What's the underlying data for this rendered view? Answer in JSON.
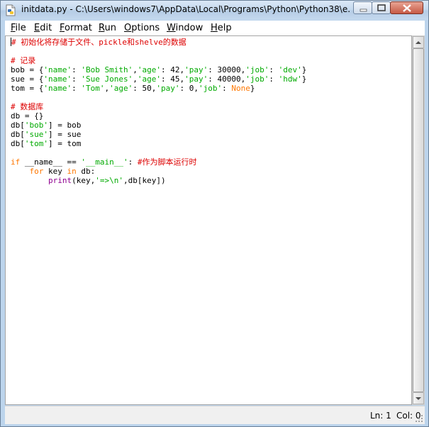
{
  "window": {
    "title": "initdata.py - C:\\Users\\windows7\\AppData\\Local\\Programs\\Python\\Python38\\e...",
    "app_icon": "python-file-icon"
  },
  "menu": [
    {
      "first": "F",
      "rest": "ile"
    },
    {
      "first": "E",
      "rest": "dit"
    },
    {
      "first": "F",
      "rest": "ormat"
    },
    {
      "first": "R",
      "rest": "un"
    },
    {
      "first": "O",
      "rest": "ptions"
    },
    {
      "first": "W",
      "rest": "indow"
    },
    {
      "first": "H",
      "rest": "elp"
    }
  ],
  "code_lines": [
    [
      {
        "t": "# 初始化将存储于文件、pickle和shelve的数据",
        "c": "cm"
      }
    ],
    [],
    [
      {
        "t": "# 记录",
        "c": "cm"
      }
    ],
    [
      {
        "t": "bob = {"
      },
      {
        "t": "'name'",
        "c": "str"
      },
      {
        "t": ": "
      },
      {
        "t": "'Bob Smith'",
        "c": "str"
      },
      {
        "t": ","
      },
      {
        "t": "'age'",
        "c": "str"
      },
      {
        "t": ": 42,"
      },
      {
        "t": "'pay'",
        "c": "str"
      },
      {
        "t": ": 30000,"
      },
      {
        "t": "'job'",
        "c": "str"
      },
      {
        "t": ": "
      },
      {
        "t": "'dev'",
        "c": "str"
      },
      {
        "t": "}"
      }
    ],
    [
      {
        "t": "sue = {"
      },
      {
        "t": "'name'",
        "c": "str"
      },
      {
        "t": ": "
      },
      {
        "t": "'Sue Jones'",
        "c": "str"
      },
      {
        "t": ","
      },
      {
        "t": "'age'",
        "c": "str"
      },
      {
        "t": ": 45,"
      },
      {
        "t": "'pay'",
        "c": "str"
      },
      {
        "t": ": 40000,"
      },
      {
        "t": "'job'",
        "c": "str"
      },
      {
        "t": ": "
      },
      {
        "t": "'hdw'",
        "c": "str"
      },
      {
        "t": "}"
      }
    ],
    [
      {
        "t": "tom = {"
      },
      {
        "t": "'name'",
        "c": "str"
      },
      {
        "t": ": "
      },
      {
        "t": "'Tom'",
        "c": "str"
      },
      {
        "t": ","
      },
      {
        "t": "'age'",
        "c": "str"
      },
      {
        "t": ": 50,"
      },
      {
        "t": "'pay'",
        "c": "str"
      },
      {
        "t": ": 0,"
      },
      {
        "t": "'job'",
        "c": "str"
      },
      {
        "t": ": "
      },
      {
        "t": "None",
        "c": "kw"
      },
      {
        "t": "}"
      }
    ],
    [],
    [
      {
        "t": "# 数据库",
        "c": "cm"
      }
    ],
    [
      {
        "t": "db = {}"
      }
    ],
    [
      {
        "t": "db["
      },
      {
        "t": "'bob'",
        "c": "str"
      },
      {
        "t": "] = bob"
      }
    ],
    [
      {
        "t": "db["
      },
      {
        "t": "'sue'",
        "c": "str"
      },
      {
        "t": "] = sue"
      }
    ],
    [
      {
        "t": "db["
      },
      {
        "t": "'tom'",
        "c": "str"
      },
      {
        "t": "] = tom"
      }
    ],
    [],
    [
      {
        "t": "if",
        "c": "kw"
      },
      {
        "t": " __name__ == "
      },
      {
        "t": "'__main__'",
        "c": "str"
      },
      {
        "t": ": "
      },
      {
        "t": "#作为脚本运行时",
        "c": "cm"
      }
    ],
    [
      {
        "t": "    "
      },
      {
        "t": "for",
        "c": "kw"
      },
      {
        "t": " key "
      },
      {
        "t": "in",
        "c": "kw"
      },
      {
        "t": " db:"
      }
    ],
    [
      {
        "t": "        "
      },
      {
        "t": "print",
        "c": "bi"
      },
      {
        "t": "(key,"
      },
      {
        "t": "'=>\\n'",
        "c": "str"
      },
      {
        "t": ",db[key])"
      }
    ]
  ],
  "status": {
    "line": "Ln: 1",
    "col": "Col: 0"
  },
  "colors": {
    "keyword": "#ff7700",
    "string": "#00aa00",
    "comment": "#dd0000",
    "builtin": "#900090"
  }
}
